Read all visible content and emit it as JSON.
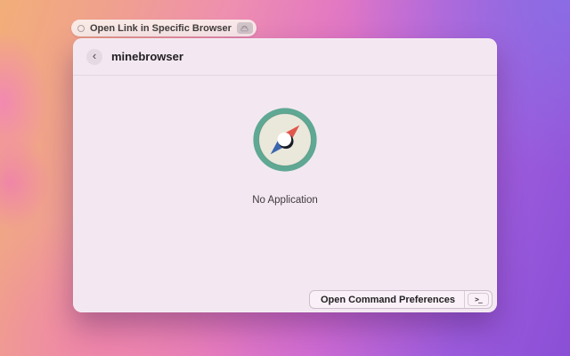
{
  "hud_pill": {
    "label": "Open Link in Specific Browser"
  },
  "window": {
    "search": {
      "value": "minebrowser",
      "placeholder": ""
    },
    "empty_state": {
      "message": "No Application"
    },
    "footer": {
      "button_label": "Open Command Preferences",
      "shortcut_glyph": ">_"
    }
  },
  "icons": {
    "back": "‹",
    "hud_left": "ring-icon",
    "hud_right": "device-badge-icon",
    "empty_state": "compass-icon"
  },
  "colors": {
    "compass_ring": "#5FA893",
    "compass_face": "#EAE8DB",
    "needle_north_red": "#E2574C",
    "needle_south_blue": "#3A67AD",
    "hub_dark": "#171C26",
    "hub_white": "#FFFFFF",
    "window_bg": "#F3E8F1",
    "wallpaper_peach": "#F2AE79",
    "wallpaper_pink": "#EE8FB0",
    "wallpaper_magenta": "#D96ECC",
    "wallpaper_purple": "#8A4FD6"
  }
}
